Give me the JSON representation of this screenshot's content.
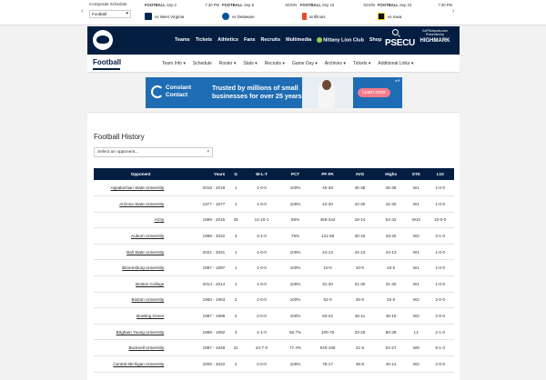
{
  "ticker": {
    "schedule_label": "Composite Schedule",
    "sport_select": "Football",
    "prev_arrow": "‹",
    "next_arrow": "›",
    "games": [
      {
        "sport": "FOOTBALL",
        "date": "Sep 2",
        "time": "7:30 PM",
        "opponent": "vs West Virginia",
        "logo_color": "#002855"
      },
      {
        "sport": "FOOTBALL",
        "date": "Sep 9",
        "time": "NOON",
        "opponent": "vs Delaware",
        "logo_color": "#00539f"
      },
      {
        "sport": "FOOTBALL",
        "date": "Sep 16",
        "time": "NOON",
        "opponent": "at Illinois",
        "logo_color": "#e84a27"
      },
      {
        "sport": "FOOTBALL",
        "date": "Sep 23",
        "time": "7:30 PM",
        "opponent": "vs Iowa",
        "logo_color": "#111111"
      }
    ]
  },
  "header": {
    "nav": [
      "Teams",
      "Tickets",
      "Athletics",
      "Fans",
      "Recruits",
      "Multimedia",
      "Nittany Lion Club",
      "Shop"
    ],
    "sponsor_name": "PSECU",
    "sponsor_line1": "GoPSUsports.com",
    "sponsor_line2": "Presented by",
    "sponsor_brand": "HIGHMARK"
  },
  "subnav": {
    "title": "Football",
    "items": [
      "Team Info",
      "Schedule",
      "Roster",
      "Stats",
      "Recruits",
      "Game Day",
      "Archives",
      "Tickets",
      "Additional Links"
    ]
  },
  "ad": {
    "brand_line1": "Constant",
    "brand_line2": "Contact",
    "message_line1": "Trusted by millions of small",
    "message_line2": "businesses for over 25 years.",
    "button": "Learn more"
  },
  "history": {
    "title": "Football History",
    "select_placeholder": "Select an opponent...",
    "columns": [
      "Opponent",
      "Years",
      "G",
      "W-L-T",
      "PCT",
      "PF-PA",
      "AVG",
      "Highs",
      "STK",
      "L10"
    ],
    "rows": [
      [
        "Appalachian State University",
        "2018 - 2018",
        "1",
        "1-0-0",
        "100%",
        "45-38",
        "45-38",
        "45-38",
        "W1",
        "1-0-0"
      ],
      [
        "Arizona State University",
        "1977 - 1977",
        "1",
        "1-0-0",
        "100%",
        "42-30",
        "42-30",
        "42-30",
        "W1",
        "1-0-0"
      ],
      [
        "Army",
        "1899 - 2015",
        "25",
        "14-10-1",
        "58%",
        "456-342",
        "18-14",
        "54-42",
        "W10",
        "10-0-0"
      ],
      [
        "Auburn University",
        "1996 - 2022",
        "4",
        "3-1-0",
        "75%",
        "121-59",
        "30-15",
        "43-20",
        "W2",
        "3-1-0"
      ],
      [
        "Ball State University",
        "2021 - 2021",
        "1",
        "1-0-0",
        "100%",
        "44-13",
        "44-13",
        "44-13",
        "W1",
        "1-0-0"
      ],
      [
        "Bloomsburg University",
        "1897 - 1897",
        "1",
        "1-0-0",
        "100%",
        "10-0",
        "10-0",
        "10-0",
        "W1",
        "1-0-0"
      ],
      [
        "Boston College",
        "2014 - 2014",
        "1",
        "1-0-0",
        "100%",
        "31-30",
        "31-30",
        "31-30",
        "W1",
        "1-0-0"
      ],
      [
        "Boston University",
        "1960 - 1963",
        "2",
        "2-0-0",
        "100%",
        "52-0",
        "26-0",
        "32-0",
        "W2",
        "2-0-0"
      ],
      [
        "Bowling Green",
        "1987 - 1998",
        "2",
        "2-0-0",
        "100%",
        "93-22",
        "46-11",
        "48-19",
        "W2",
        "2-0-0"
      ],
      [
        "Brigham Young University",
        "1989 - 1992",
        "3",
        "2-1-0",
        "66.7%",
        "100-76",
        "33-25",
        "50-39",
        "L1",
        "2-1-0"
      ],
      [
        "Bucknell University",
        "1887 - 1948",
        "31",
        "24-7-0",
        "77.4%",
        "640-168",
        "21-5",
        "54-27",
        "W9",
        "8-1-0"
      ],
      [
        "Central Michigan University",
        "2005 - 2022",
        "2",
        "2-0-0",
        "100%",
        "78-17",
        "39-8",
        "40-14",
        "W2",
        "2-0-0"
      ]
    ]
  }
}
